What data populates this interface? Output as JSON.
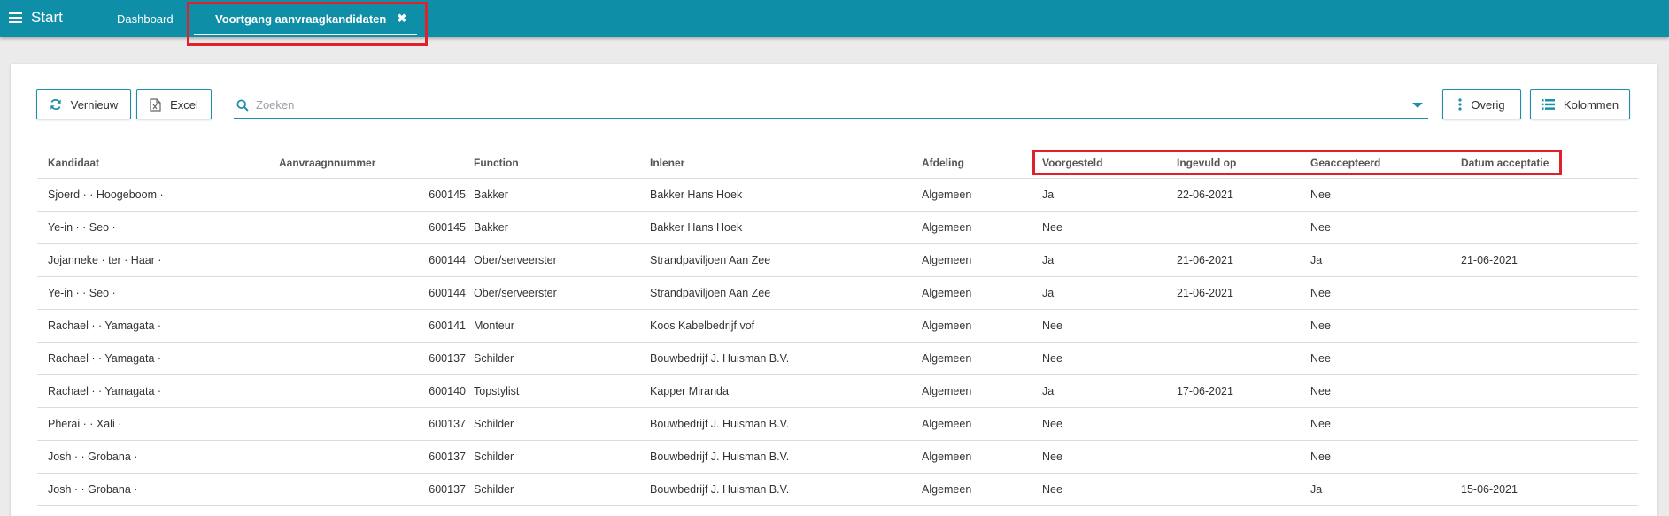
{
  "app": {
    "start_label": "Start"
  },
  "tabs": [
    {
      "label": "Dashboard"
    },
    {
      "label": "Voortgang aanvraagkandidaten",
      "close": "✖"
    }
  ],
  "toolbar": {
    "refresh_label": "Vernieuw",
    "excel_label": "Excel",
    "search_placeholder": "Zoeken",
    "more_label": "Overig",
    "columns_label": "Kolommen"
  },
  "table": {
    "columns": [
      "Kandidaat",
      "Aanvraagnnummer",
      "Function",
      "Inlener",
      "Afdeling",
      "Voorgesteld",
      "Ingevuld op",
      "Geaccepteerd",
      "Datum acceptatie"
    ],
    "rows": [
      [
        "Sjoerd · · Hoogeboom ·",
        "600145",
        "Bakker",
        "Bakker Hans Hoek",
        "Algemeen",
        "Ja",
        "22-06-2021",
        "Nee",
        ""
      ],
      [
        "Ye-in · · Seo ·",
        "600145",
        "Bakker",
        "Bakker Hans Hoek",
        "Algemeen",
        "Nee",
        "",
        "Nee",
        ""
      ],
      [
        "Jojanneke · ter · Haar ·",
        "600144",
        "Ober/serveerster",
        "Strandpaviljoen Aan Zee",
        "Algemeen",
        "Ja",
        "21-06-2021",
        "Ja",
        "21-06-2021"
      ],
      [
        "Ye-in · · Seo ·",
        "600144",
        "Ober/serveerster",
        "Strandpaviljoen Aan Zee",
        "Algemeen",
        "Ja",
        "21-06-2021",
        "Nee",
        ""
      ],
      [
        "Rachael · · Yamagata ·",
        "600141",
        "Monteur",
        "Koos Kabelbedrijf vof",
        "Algemeen",
        "Nee",
        "",
        "Nee",
        ""
      ],
      [
        "Rachael · · Yamagata ·",
        "600137",
        "Schilder",
        "Bouwbedrijf J. Huisman B.V.",
        "Algemeen",
        "Nee",
        "",
        "Nee",
        ""
      ],
      [
        "Rachael · · Yamagata ·",
        "600140",
        "Topstylist",
        "Kapper Miranda",
        "Algemeen",
        "Ja",
        "17-06-2021",
        "Nee",
        ""
      ],
      [
        "Pherai · · Xali ·",
        "600137",
        "Schilder",
        "Bouwbedrijf J. Huisman B.V.",
        "Algemeen",
        "Nee",
        "",
        "Nee",
        ""
      ],
      [
        "Josh · · Grobana ·",
        "600137",
        "Schilder",
        "Bouwbedrijf J. Huisman B.V.",
        "Algemeen",
        "Nee",
        "",
        "Nee",
        ""
      ],
      [
        "Josh · · Grobana ·",
        "600137",
        "Schilder",
        "Bouwbedrijf J. Huisman B.V.",
        "Algemeen",
        "Nee",
        "",
        "Ja",
        "15-06-2021"
      ]
    ]
  },
  "colors": {
    "header": "#0f8ea8",
    "accent": "#1a8fa8",
    "highlight_box": "#e0202a"
  },
  "icons": [
    "menu-icon",
    "close-icon",
    "refresh-icon",
    "excel-icon",
    "search-icon",
    "dropdown-caret-icon",
    "more-vertical-icon",
    "columns-list-icon"
  ]
}
